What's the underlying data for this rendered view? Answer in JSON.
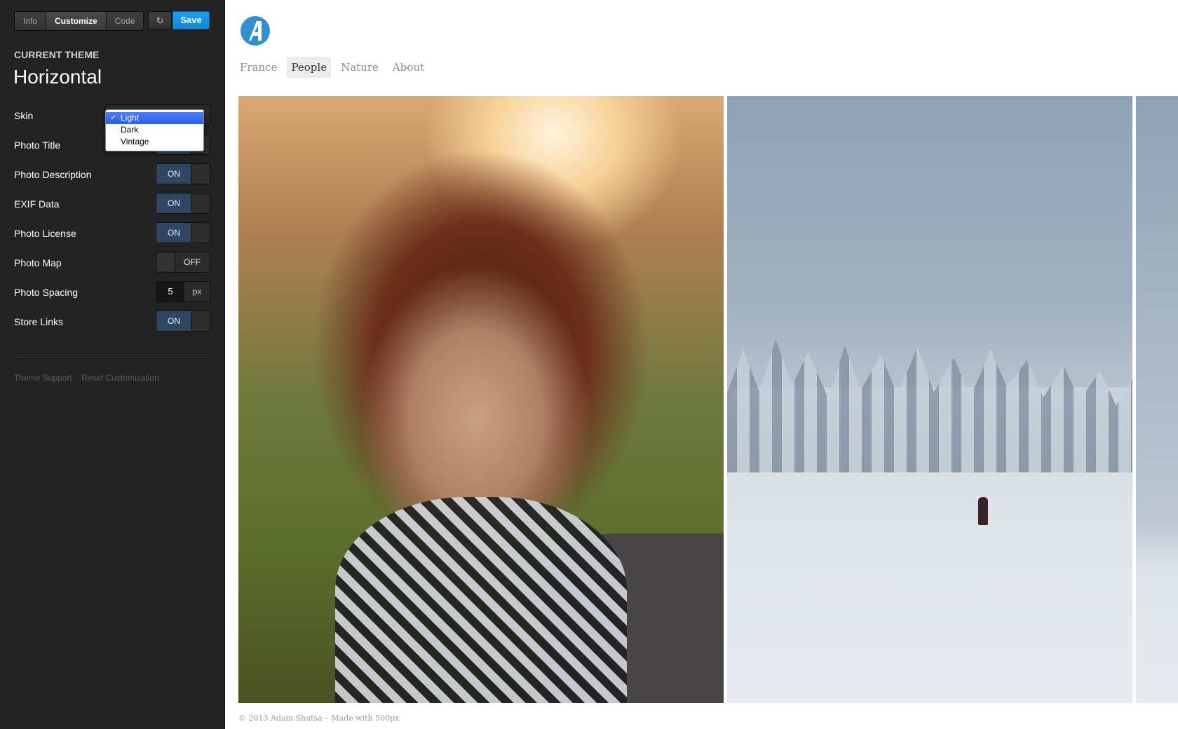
{
  "toolbar": {
    "tabs": [
      {
        "label": "Info"
      },
      {
        "label": "Customize"
      },
      {
        "label": "Code"
      }
    ],
    "refresh_icon": "↻",
    "save_label": "Save",
    "save_color": "#1496e6"
  },
  "theme": {
    "label": "CURRENT THEME",
    "name": "Horizontal"
  },
  "settings": {
    "skin": {
      "label": "Skin",
      "options": [
        "Light",
        "Dark",
        "Vintage"
      ],
      "selected": "Light",
      "check": "✓"
    },
    "photo_title": {
      "label": "Photo Title",
      "value": "ON"
    },
    "photo_description": {
      "label": "Photo Description",
      "value": "ON"
    },
    "exif_data": {
      "label": "EXIF Data",
      "value": "ON"
    },
    "photo_license": {
      "label": "Photo License",
      "value": "ON"
    },
    "photo_map": {
      "label": "Photo Map",
      "value": "OFF"
    },
    "photo_spacing": {
      "label": "Photo Spacing",
      "value": "5",
      "unit": "px"
    },
    "store_links": {
      "label": "Store Links",
      "value": "ON"
    }
  },
  "sidebar_links": {
    "theme_support": "Theme Support",
    "reset": "Reset Customization"
  },
  "site": {
    "logo_letter": "A",
    "logo_color": "#2f8fcf",
    "nav": [
      {
        "label": "France"
      },
      {
        "label": "People"
      },
      {
        "label": "Nature"
      },
      {
        "label": "About"
      }
    ],
    "active_nav": "People",
    "footer": "© 2013 Adam Shutsa – Made with 500px"
  }
}
